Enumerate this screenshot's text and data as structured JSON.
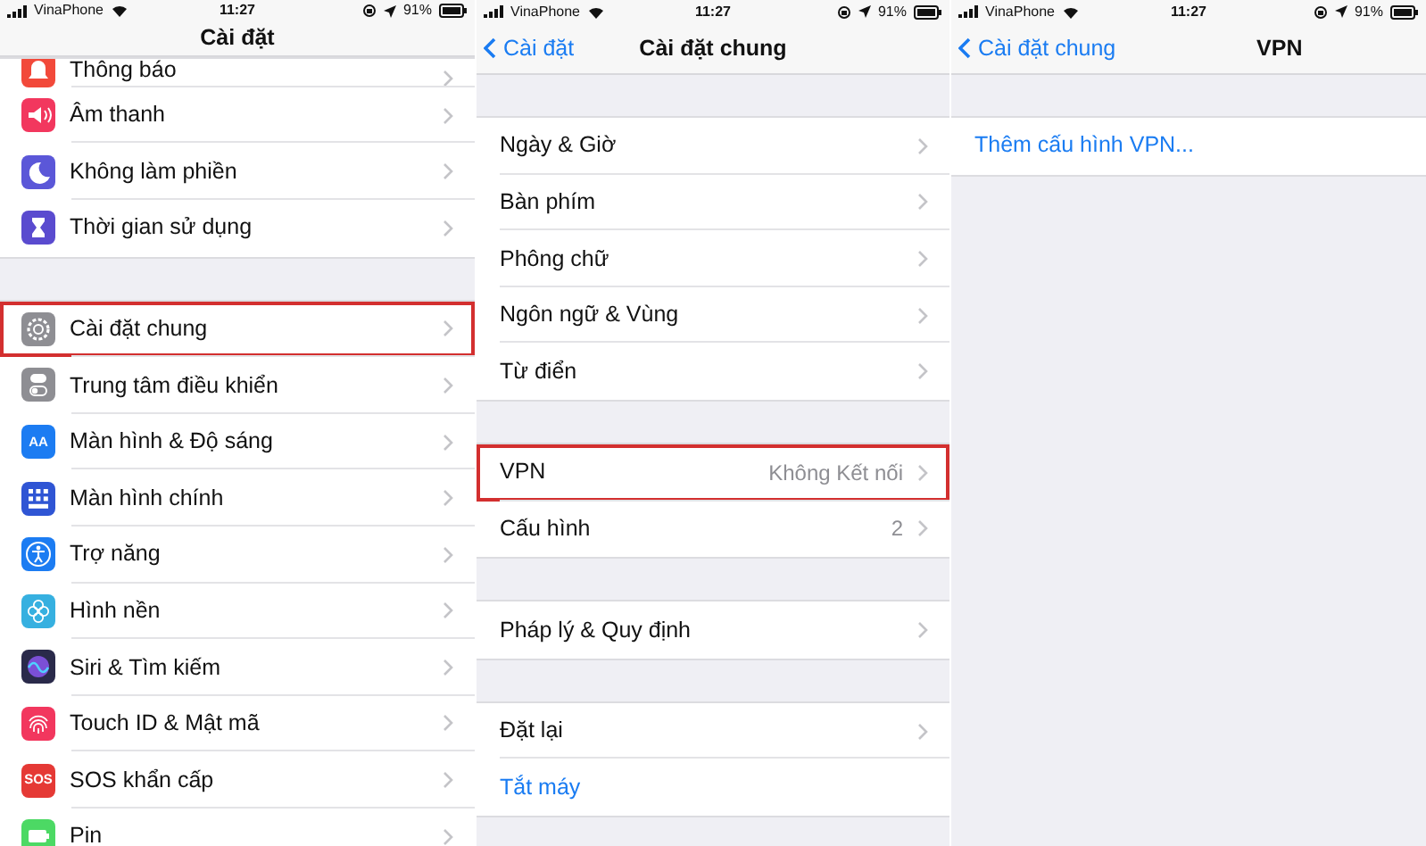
{
  "screens": [
    {
      "status_bar": {
        "carrier": "VinaPhone",
        "time": "11:27",
        "battery": "91%"
      },
      "nav": {
        "title": "Cài đặt"
      },
      "groups": [
        {
          "rows": [
            {
              "kind": "icon",
              "label": "Thông báo",
              "color": "#f2493a",
              "highlighted": false
            },
            {
              "kind": "icon",
              "label": "Âm thanh",
              "color": "#f2375e",
              "highlighted": false
            },
            {
              "kind": "icon",
              "label": "Không làm phiền",
              "color": "#5b57d8",
              "highlighted": false
            },
            {
              "kind": "icon",
              "label": "Thời gian sử dụng",
              "color": "#5a4bcf",
              "highlighted": false
            }
          ]
        },
        {
          "rows": [
            {
              "kind": "icon",
              "label": "Cài đặt chung",
              "color": "#8e8e93",
              "highlighted": true
            },
            {
              "kind": "icon",
              "label": "Trung tâm điều khiển",
              "color": "#8e8e93",
              "highlighted": false
            },
            {
              "kind": "icon",
              "label": "Màn hình & Độ sáng",
              "color": "#1c7cf2",
              "icon_text": "AA",
              "highlighted": false
            },
            {
              "kind": "icon",
              "label": "Màn hình chính",
              "color": "#2f55d4",
              "highlighted": false
            },
            {
              "kind": "icon",
              "label": "Trợ năng",
              "color": "#1c7cf2",
              "highlighted": false
            },
            {
              "kind": "icon",
              "label": "Hình nền",
              "color": "#36b0e0",
              "highlighted": false
            },
            {
              "kind": "icon",
              "label": "Siri & Tìm kiếm",
              "color": "#2a2a4a",
              "highlighted": false
            },
            {
              "kind": "icon",
              "label": "Touch ID & Mật mã",
              "color": "#f2375e",
              "highlighted": false
            },
            {
              "kind": "icon",
              "label": "SOS khẩn cấp",
              "color": "#e53935",
              "icon_text": "SOS",
              "highlighted": false
            },
            {
              "kind": "icon",
              "label": "Pin",
              "color": "#4cd964",
              "highlighted": false
            }
          ]
        }
      ]
    },
    {
      "status_bar": {
        "carrier": "VinaPhone",
        "time": "11:27",
        "battery": "91%"
      },
      "nav": {
        "back": "Cài đặt",
        "title": "Cài đặt chung"
      },
      "groups": [
        {
          "rows": [
            {
              "kind": "plain",
              "label": "Ngày & Giờ",
              "highlighted": false
            },
            {
              "kind": "plain",
              "label": "Bàn phím",
              "highlighted": false
            },
            {
              "kind": "plain",
              "label": "Phông chữ",
              "highlighted": false
            },
            {
              "kind": "plain",
              "label": "Ngôn ngữ & Vùng",
              "highlighted": false
            },
            {
              "kind": "plain",
              "label": "Từ điển",
              "highlighted": false
            }
          ]
        },
        {
          "rows": [
            {
              "kind": "plain",
              "label": "VPN",
              "value": "Không Kết nối",
              "highlighted": true
            },
            {
              "kind": "plain",
              "label": "Cấu hình",
              "value": "2",
              "highlighted": false
            }
          ]
        },
        {
          "rows": [
            {
              "kind": "plain",
              "label": "Pháp lý & Quy định",
              "highlighted": false
            }
          ]
        },
        {
          "rows": [
            {
              "kind": "plain",
              "label": "Đặt lại",
              "highlighted": false
            },
            {
              "kind": "action",
              "label": "Tắt máy",
              "highlighted": false
            }
          ]
        }
      ]
    },
    {
      "status_bar": {
        "carrier": "VinaPhone",
        "time": "11:27",
        "battery": "91%"
      },
      "nav": {
        "back": "Cài đặt chung",
        "title": "VPN"
      },
      "groups": [
        {
          "rows": [
            {
              "kind": "action",
              "label": "Thêm cấu hình VPN...",
              "highlighted": false
            }
          ]
        }
      ]
    }
  ]
}
